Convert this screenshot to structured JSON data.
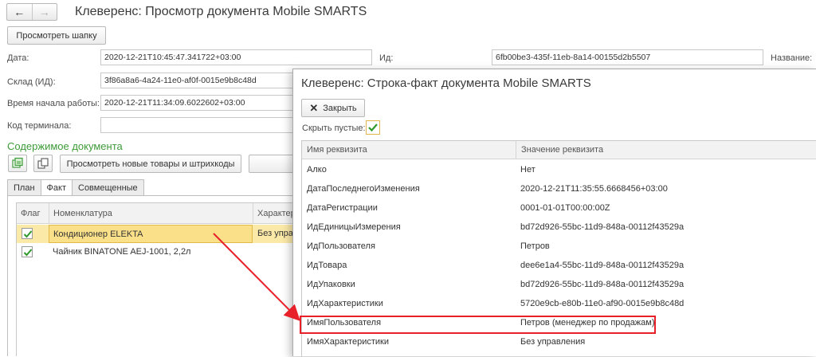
{
  "window": {
    "title": "Клеверенс: Просмотр документа Mobile SMARTS",
    "view_header_button": "Просмотреть шапку"
  },
  "form": {
    "date_label": "Дата:",
    "date_value": "2020-12-21T10:45:47.341722+03:00",
    "id_label": "Ид:",
    "id_value": "6fb00be3-435f-11eb-8a14-00155d2b5507",
    "name_label": "Название:",
    "warehouse_label": "Склад (ИД):",
    "warehouse_value": "3f86a8a6-4a24-11e0-af0f-0015e9b8c48d",
    "start_time_label": "Время начала работы:",
    "start_time_value": "2020-12-21T11:34:09.6022602+03:00",
    "terminal_label": "Код терминала:",
    "terminal_value": ""
  },
  "content": {
    "section_title": "Содержимое документа",
    "view_new_button": "Просмотреть новые товары и штрихкоды"
  },
  "tabs": [
    "План",
    "Факт",
    "Совмещенные"
  ],
  "active_tab": "Факт",
  "grid": {
    "columns": [
      "Флаг",
      "Номенклатура",
      "Характер"
    ],
    "rows": [
      {
        "flag": true,
        "name": "Кондиционер ELEKTA",
        "char": "Без управ"
      },
      {
        "flag": true,
        "name": "Чайник BINATONE  AEJ-1001,  2,2л",
        "char": ""
      }
    ]
  },
  "dialog": {
    "title": "Клеверенс: Строка-факт документа Mobile SMARTS",
    "close_button": "Закрыть",
    "hide_empty_label": "Скрыть пустые:",
    "hide_empty_checked": true,
    "columns": [
      "Имя реквизита",
      "Значение реквизита"
    ],
    "rows": [
      {
        "name": "Алко",
        "value": "Нет"
      },
      {
        "name": "ДатаПоследнегоИзменения",
        "value": "2020-12-21T11:35:55.6668456+03:00"
      },
      {
        "name": "ДатаРегистрации",
        "value": "0001-01-01T00:00:00Z"
      },
      {
        "name": "ИдЕдиницыИзмерения",
        "value": "bd72d926-55bc-11d9-848a-00112f43529a"
      },
      {
        "name": "ИдПользователя",
        "value": "Петров"
      },
      {
        "name": "ИдТовара",
        "value": "dee6e1a4-55bc-11d9-848a-00112f43529a"
      },
      {
        "name": "ИдУпаковки",
        "value": "bd72d926-55bc-11d9-848a-00112f43529a"
      },
      {
        "name": "ИдХарактеристики",
        "value": "5720e9cb-e80b-11e0-af90-0015e9b8c48d"
      },
      {
        "name": "ИмяПользователя",
        "value": "Петров (менеджер по продажам)"
      },
      {
        "name": "ИмяХарактеристики",
        "value": "Без управления"
      }
    ]
  },
  "colors": {
    "accent_green": "#3e9b39",
    "selected_row": "#fbe08a",
    "highlight_red": "#e8202a"
  }
}
